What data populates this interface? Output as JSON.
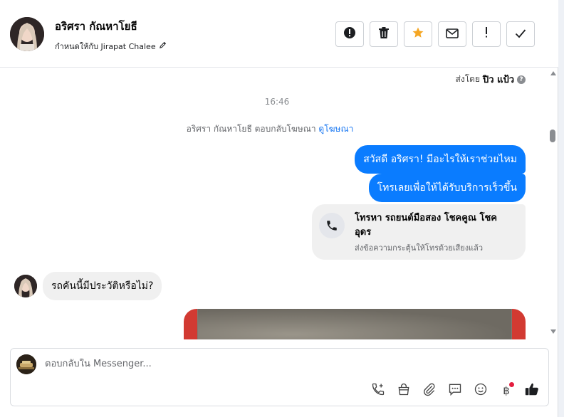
{
  "header": {
    "contact_name": "อริศรา กัณหาโยธี",
    "assigned_label": "กำหนดให้กับ Jirapat Chalee",
    "actions": [
      {
        "name": "spam-icon"
      },
      {
        "name": "trash-icon"
      },
      {
        "name": "star-icon"
      },
      {
        "name": "mail-icon"
      },
      {
        "name": "important-icon"
      },
      {
        "name": "done-icon"
      }
    ]
  },
  "chat": {
    "sent_by_prefix": "ส่งโดย",
    "sent_by_name": "ปิว แป้ว",
    "time": "16:46",
    "reply_note": "อริศรา กัณหาโยธี ตอบกลับโฆษณา",
    "reply_link": "ดูโฆษณา",
    "out_messages": [
      "สวัสดี อริศรา! มีอะไรให้เราช่วยไหม",
      "โทรเลยเพื่อให้ได้รับบริการเร็วขึ้น"
    ],
    "call_card": {
      "title": "โทรหา รถยนต์มือสอง โชคคูณ โชค อุดร",
      "subtitle": "ส่งข้อความกระตุ้นให้โทรด้วยเสียงแล้ว"
    },
    "in_message": "รถคันนี้มีประวัติหรือไม่?"
  },
  "composer": {
    "placeholder": "ตอบกลับใน Messenger...",
    "tools": [
      "phone-plus-icon",
      "shopping-bag-icon",
      "paperclip-icon",
      "saved-reply-icon",
      "emoji-icon",
      "baht-icon",
      "thumbs-up-icon"
    ]
  },
  "colors": {
    "accent": "#0a7cff",
    "star": "#f5a623",
    "notification": "#e41e3f"
  }
}
